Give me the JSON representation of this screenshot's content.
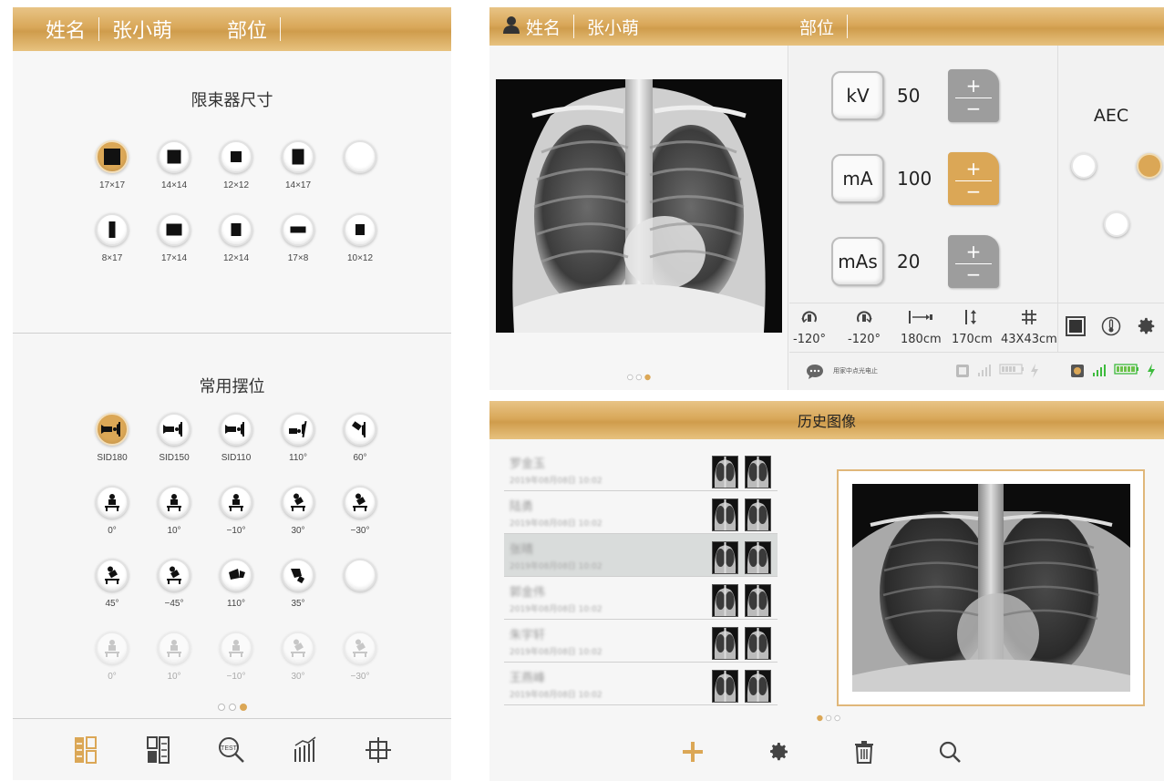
{
  "left": {
    "header": {
      "name_label": "姓名",
      "name_value": "张小萌",
      "position_label": "部位"
    },
    "collimator": {
      "title": "限束器尺寸",
      "rows": [
        [
          {
            "label": "17×17",
            "state": "active",
            "glyph": "sq-large"
          },
          {
            "label": "14×14",
            "state": "normal",
            "glyph": "sq-med"
          },
          {
            "label": "12×12",
            "state": "normal",
            "glyph": "sq-small"
          },
          {
            "label": "14×17",
            "state": "normal",
            "glyph": "rect-tall"
          },
          {
            "label": "",
            "state": "empty",
            "glyph": ""
          }
        ],
        [
          {
            "label": "8×17",
            "state": "normal",
            "glyph": "rect-narrow"
          },
          {
            "label": "17×14",
            "state": "normal",
            "glyph": "rect-wide"
          },
          {
            "label": "12×14",
            "state": "normal",
            "glyph": "rect-small-tall"
          },
          {
            "label": "17×8",
            "state": "normal",
            "glyph": "rect-flat"
          },
          {
            "label": "10×12",
            "state": "normal",
            "glyph": "sq-tiny"
          }
        ]
      ]
    },
    "positions": {
      "title": "常用摆位",
      "rows": [
        [
          {
            "label": "SID180",
            "state": "active",
            "glyph": "sid"
          },
          {
            "label": "SID150",
            "state": "normal",
            "glyph": "sid"
          },
          {
            "label": "SID110",
            "state": "normal",
            "glyph": "sid"
          },
          {
            "label": "110°",
            "state": "normal",
            "glyph": "tilt"
          },
          {
            "label": "60°",
            "state": "normal",
            "glyph": "tilt2"
          }
        ],
        [
          {
            "label": "0°",
            "state": "normal",
            "glyph": "table"
          },
          {
            "label": "10°",
            "state": "normal",
            "glyph": "table"
          },
          {
            "label": "−10°",
            "state": "normal",
            "glyph": "table"
          },
          {
            "label": "30°",
            "state": "normal",
            "glyph": "table-tilt"
          },
          {
            "label": "−30°",
            "state": "normal",
            "glyph": "table-tilt"
          }
        ],
        [
          {
            "label": "45°",
            "state": "normal",
            "glyph": "table-tilt"
          },
          {
            "label": "−45°",
            "state": "normal",
            "glyph": "table-tilt"
          },
          {
            "label": "110°",
            "state": "normal",
            "glyph": "lamp"
          },
          {
            "label": "35°",
            "state": "normal",
            "glyph": "lamp2"
          },
          {
            "label": "",
            "state": "empty",
            "glyph": ""
          }
        ],
        [
          {
            "label": "0°",
            "state": "faded",
            "glyph": "table"
          },
          {
            "label": "10°",
            "state": "faded",
            "glyph": "table"
          },
          {
            "label": "−10°",
            "state": "faded",
            "glyph": "table"
          },
          {
            "label": "30°",
            "state": "faded",
            "glyph": "table-tilt"
          },
          {
            "label": "−30°",
            "state": "faded",
            "glyph": "table-tilt"
          }
        ]
      ]
    },
    "pager": [
      false,
      false,
      true
    ],
    "toolbar": [
      "ruler-grid-icon",
      "layout-icon",
      "test-zoom-icon",
      "chart-icon",
      "crosshair-icon"
    ]
  },
  "rtop": {
    "header": {
      "name_label": "姓名",
      "name_value": "张小萌",
      "position_label": "部位"
    },
    "pager": [
      false,
      false,
      true
    ],
    "params": [
      {
        "key": "kV",
        "value": "50",
        "active": false
      },
      {
        "key": "mA",
        "value": "100",
        "active": true
      },
      {
        "key": "mAs",
        "value": "20",
        "active": false
      }
    ],
    "btn_plus": "+",
    "btn_minus": "−",
    "aec": {
      "title": "AEC"
    },
    "geometry": [
      {
        "icon": "rotate-left-icon",
        "value": "-120°"
      },
      {
        "icon": "rotate-right-icon",
        "value": "-120°"
      },
      {
        "icon": "horizontal-distance-icon",
        "value": "180cm"
      },
      {
        "icon": "vertical-distance-icon",
        "value": "170cm"
      },
      {
        "icon": "grid-size-icon",
        "value": "43X43cm"
      }
    ],
    "status_msg": "用家中点光电止",
    "colors": {
      "accent": "#dba756",
      "battery": "#6cc24a",
      "bolt": "#3dbb3d"
    }
  },
  "rbot": {
    "title": "历史图像",
    "history": [
      {
        "name": "罗金玉",
        "date": "2019年08月08日 10:02",
        "selected": false
      },
      {
        "name": "陆勇",
        "date": "2019年08月08日 10:02",
        "selected": false
      },
      {
        "name": "张晴",
        "date": "2019年08月08日 10:02",
        "selected": true
      },
      {
        "name": "郭金伟",
        "date": "2019年08月08日 10:02",
        "selected": false
      },
      {
        "name": "朱宇轩",
        "date": "2019年08月08日 10:02",
        "selected": false
      },
      {
        "name": "王燕峰",
        "date": "2019年08月08日 10:02",
        "selected": false
      }
    ],
    "pager": [
      true,
      false,
      false
    ],
    "toolbar": [
      "add-icon",
      "gear-icon",
      "trash-icon",
      "search-icon"
    ]
  }
}
